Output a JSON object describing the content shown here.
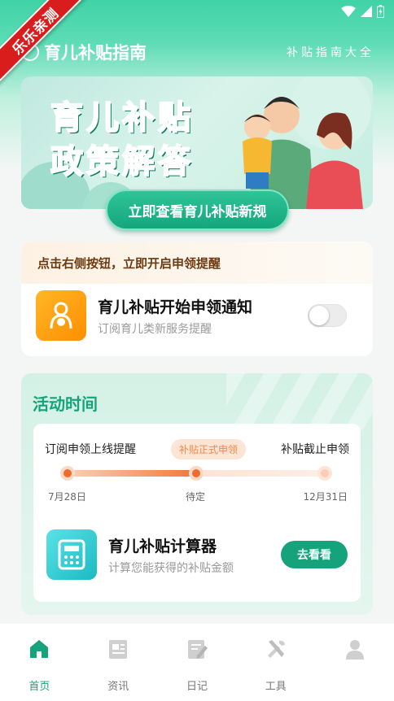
{
  "ribbon": {
    "text": "乐乐亲测"
  },
  "header": {
    "title": "育儿补贴指南",
    "slogan": "补贴指南大全"
  },
  "banner": {
    "line1": "育儿补贴",
    "line2": "政策解答",
    "cta": "立即查看育儿补贴新规"
  },
  "reminder": {
    "hint": "点击右侧按钮，立即开启申领提醒",
    "title": "育儿补贴开始申领通知",
    "subtitle": "订阅育儿类新服务提醒",
    "toggle_on": false
  },
  "activity": {
    "title": "活动时间",
    "timeline": {
      "start_label": "订阅申领上线提醒",
      "mid_label": "补贴正式申领",
      "end_label": "补贴截止申领",
      "start_date": "7月28日",
      "mid_date": "待定",
      "end_date": "12月31日"
    },
    "calculator": {
      "title": "育儿补贴计算器",
      "subtitle": "计算您能获得的补贴金额",
      "button": "去看看"
    }
  },
  "tabs": [
    {
      "label": "首页",
      "icon": "home-icon",
      "active": true
    },
    {
      "label": "资讯",
      "icon": "news-icon",
      "active": false
    },
    {
      "label": "日记",
      "icon": "diary-icon",
      "active": false
    },
    {
      "label": "工具",
      "icon": "tools-icon",
      "active": false
    },
    {
      "label": "",
      "icon": "profile-icon",
      "active": false
    }
  ],
  "colors": {
    "primary": "#16a37c",
    "accent": "#f26a2c",
    "warning": "#ffa000"
  }
}
